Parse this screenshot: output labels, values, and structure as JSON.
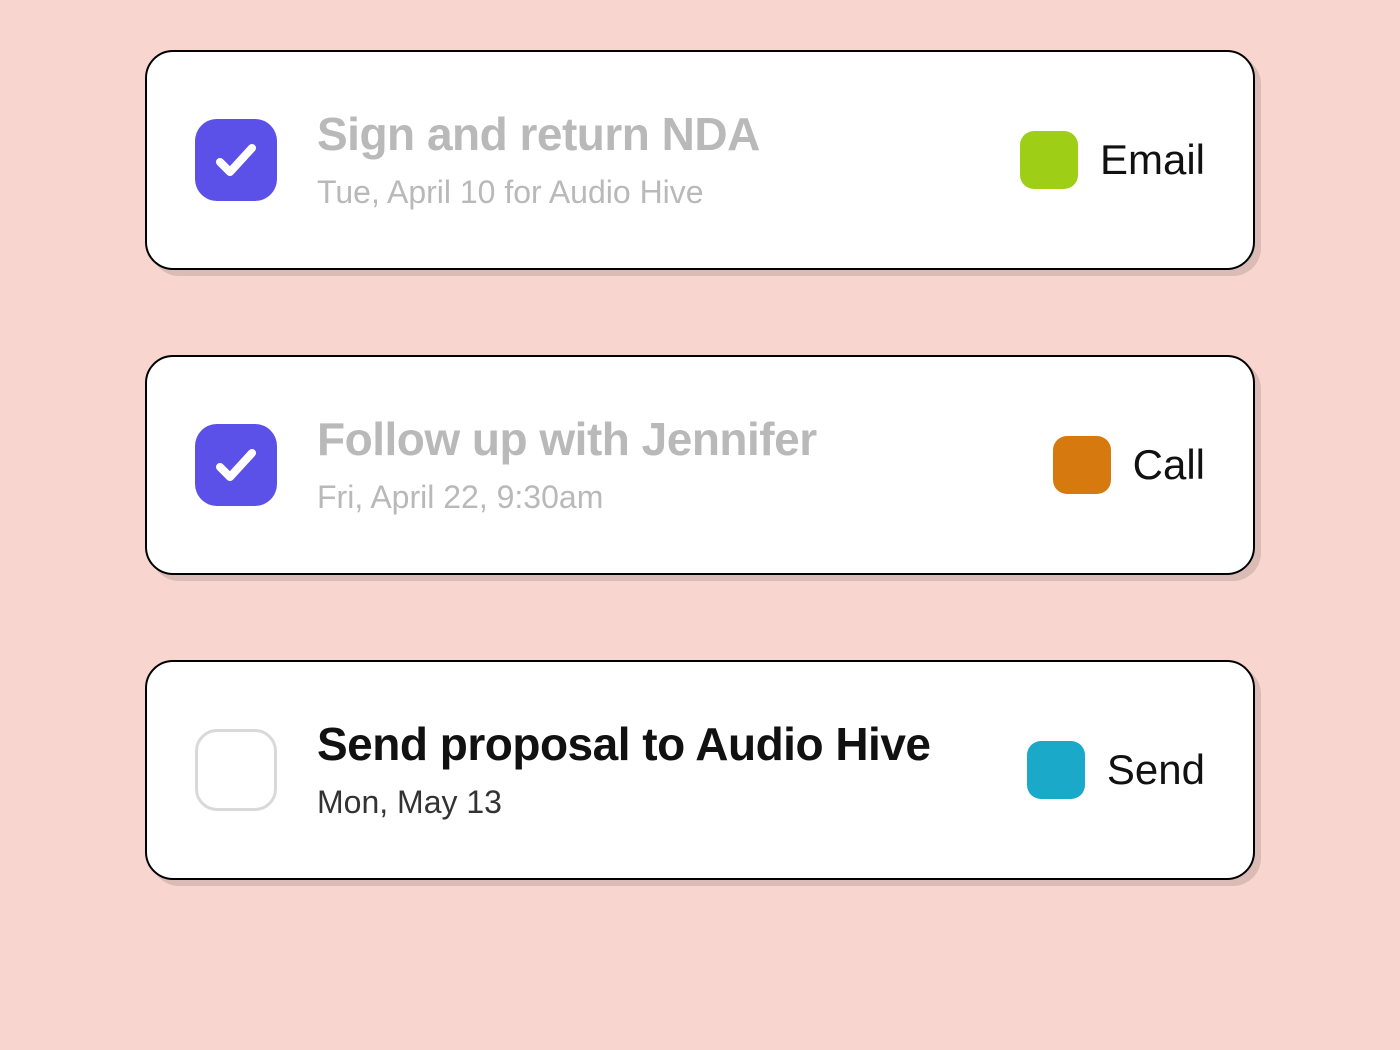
{
  "tasks": [
    {
      "title": "Sign and return NDA",
      "meta": "Tue, April 10 for Audio Hive",
      "completed": true,
      "tag": {
        "label": "Email",
        "color": "#9ecf16"
      }
    },
    {
      "title": "Follow up with Jennifer",
      "meta": "Fri, April 22, 9:30am",
      "completed": true,
      "tag": {
        "label": "Call",
        "color": "#d67a0f"
      }
    },
    {
      "title": "Send proposal to Audio Hive",
      "meta": "Mon, May 13",
      "completed": false,
      "tag": {
        "label": "Send",
        "color": "#1aa9c9"
      }
    }
  ]
}
